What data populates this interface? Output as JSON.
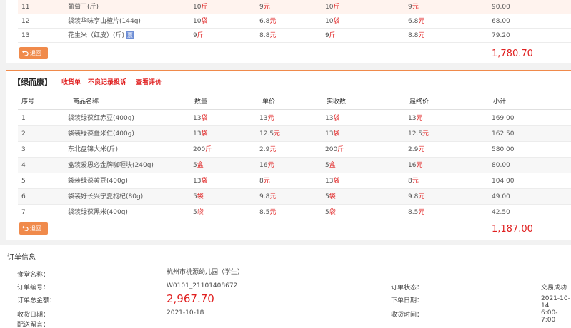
{
  "top_rows": [
    {
      "no": "11",
      "name": "葡萄干(斤)",
      "qty_num": "10",
      "qty_unit": "斤",
      "price_num": "9",
      "price_unit": "元",
      "recv_num": "10",
      "recv_unit": "斤",
      "final_num": "9",
      "final_unit": "元",
      "subtotal": "90.00",
      "badge": ""
    },
    {
      "no": "12",
      "name": "袋装华味亨山楂片(144g)",
      "qty_num": "10",
      "qty_unit": "袋",
      "price_num": "6.8",
      "price_unit": "元",
      "recv_num": "10",
      "recv_unit": "袋",
      "final_num": "6.8",
      "final_unit": "元",
      "subtotal": "68.00",
      "badge": ""
    },
    {
      "no": "13",
      "name": "花生米（红皮）(斤)",
      "qty_num": "9",
      "qty_unit": "斤",
      "price_num": "8.8",
      "price_unit": "元",
      "recv_num": "9",
      "recv_unit": "斤",
      "final_num": "8.8",
      "final_unit": "元",
      "subtotal": "79.20",
      "badge": "票"
    }
  ],
  "top_refund_label": "退回",
  "top_total": "1,780.70",
  "supplier": {
    "name": "【绿而康】",
    "links": [
      "收货单",
      "不良记录投诉",
      "查看评价"
    ]
  },
  "headers": {
    "no": "序号",
    "name": "商品名称",
    "qty": "数量",
    "price": "单价",
    "recv": "实收数",
    "final": "最终价",
    "subtotal": "小计"
  },
  "rows": [
    {
      "no": "1",
      "name": "袋装绿葆红赤豆(400g)",
      "qty_num": "13",
      "qty_unit": "袋",
      "price_num": "13",
      "price_unit": "元",
      "recv_num": "13",
      "recv_unit": "袋",
      "final_num": "13",
      "final_unit": "元",
      "subtotal": "169.00"
    },
    {
      "no": "2",
      "name": "袋装绿葆薏米仁(400g)",
      "qty_num": "13",
      "qty_unit": "袋",
      "price_num": "12.5",
      "price_unit": "元",
      "recv_num": "13",
      "recv_unit": "袋",
      "final_num": "12.5",
      "final_unit": "元",
      "subtotal": "162.50"
    },
    {
      "no": "3",
      "name": "东北盘锦大米(斤)",
      "qty_num": "200",
      "qty_unit": "斤",
      "price_num": "2.9",
      "price_unit": "元",
      "recv_num": "200",
      "recv_unit": "斤",
      "final_num": "2.9",
      "final_unit": "元",
      "subtotal": "580.00"
    },
    {
      "no": "4",
      "name": "盒装爱思必金牌咖喱块(240g)",
      "qty_num": "5",
      "qty_unit": "盒",
      "price_num": "16",
      "price_unit": "元",
      "recv_num": "5",
      "recv_unit": "盒",
      "final_num": "16",
      "final_unit": "元",
      "subtotal": "80.00"
    },
    {
      "no": "5",
      "name": "袋装绿葆黄豆(400g)",
      "qty_num": "13",
      "qty_unit": "袋",
      "price_num": "8",
      "price_unit": "元",
      "recv_num": "13",
      "recv_unit": "袋",
      "final_num": "8",
      "final_unit": "元",
      "subtotal": "104.00"
    },
    {
      "no": "6",
      "name": "袋装好长兴宁夏枸杞(80g)",
      "qty_num": "5",
      "qty_unit": "袋",
      "price_num": "9.8",
      "price_unit": "元",
      "recv_num": "5",
      "recv_unit": "袋",
      "final_num": "9.8",
      "final_unit": "元",
      "subtotal": "49.00"
    },
    {
      "no": "7",
      "name": "袋装绿葆黑米(400g)",
      "qty_num": "5",
      "qty_unit": "袋",
      "price_num": "8.5",
      "price_unit": "元",
      "recv_num": "5",
      "recv_unit": "袋",
      "final_num": "8.5",
      "final_unit": "元",
      "subtotal": "42.50"
    }
  ],
  "refund_label": "退回",
  "total": "1,187.00",
  "order_info": {
    "title": "订单信息",
    "canteen_label": "食堂名称：",
    "canteen_value": "杭州市桃源幼儿园（学生）",
    "order_no_label": "订单编号：",
    "order_no_value": "W0101_21101408672",
    "status_label": "订单状态：",
    "status_value": "交易成功",
    "amount_label": "订单总金额：",
    "amount_value": "2,967.70",
    "order_date_label": "下单日期：",
    "order_date_value": "2021-10-14",
    "recv_date_label": "收货日期：",
    "recv_date_value": "2021-10-18",
    "recv_time_label": "收货时间：",
    "recv_time_value": "6:00-7:00",
    "note_label": "配送留言："
  }
}
